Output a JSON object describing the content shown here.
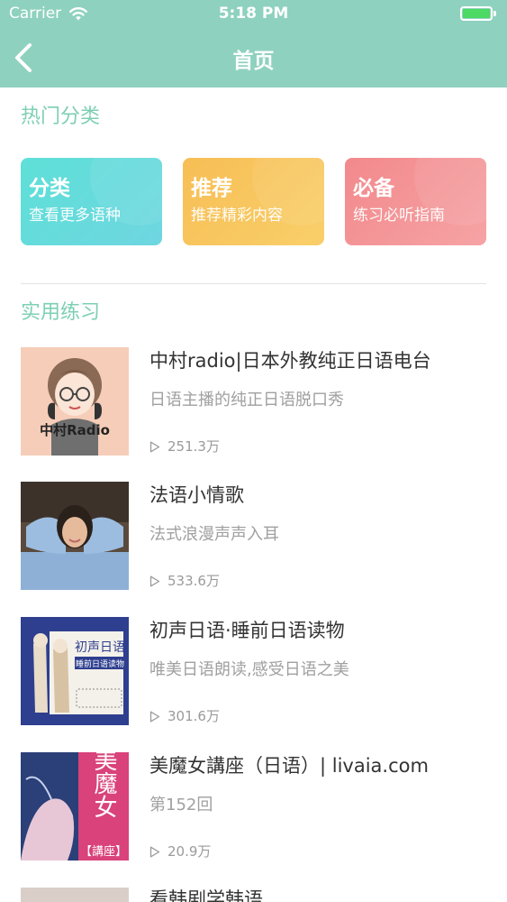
{
  "status_bar": {
    "carrier": "Carrier",
    "time": "5:18 PM",
    "wifi_icon": "wifi-icon",
    "battery_icon": "battery-icon",
    "battery_color": "#4cd964"
  },
  "nav": {
    "back_icon": "chevron-left-icon",
    "title": "首页",
    "bar_color": "#8fd1bf"
  },
  "hot_categories": {
    "title": "热门分类",
    "cards": [
      {
        "name": "分类",
        "desc": "查看更多语种",
        "color": "#5ee0d8"
      },
      {
        "name": "推荐",
        "desc": "推荐精彩内容",
        "color": "#f7be55"
      },
      {
        "name": "必备",
        "desc": "练习必听指南",
        "color": "#f2898c"
      }
    ]
  },
  "practice": {
    "title": "实用练习",
    "play_icon": "play-outline-icon",
    "items": [
      {
        "title": "中村radio|日本外教纯正日语电台",
        "subtitle": "日语主播的纯正日语脱口秀",
        "plays": "251.3万",
        "thumb_text": "中村Radio"
      },
      {
        "title": "法语小情歌",
        "subtitle": "法式浪漫声声入耳",
        "plays": "533.6万"
      },
      {
        "title": "初声日语·睡前日语读物",
        "subtitle": "唯美日语朗读,感受日语之美",
        "plays": "301.6万",
        "thumb_text": "初声日语",
        "thumb_text2": "睡前日语读物"
      },
      {
        "title": "美魔女講座（日语）| livaia.com",
        "subtitle": "第152回",
        "plays": "20.9万",
        "thumb_text": "美魔女",
        "thumb_text2": "【講座】"
      },
      {
        "title": "看韩剧学韩语"
      }
    ]
  },
  "colors": {
    "section_title": "#7ecfb5",
    "divider": "#e3e3e3"
  }
}
